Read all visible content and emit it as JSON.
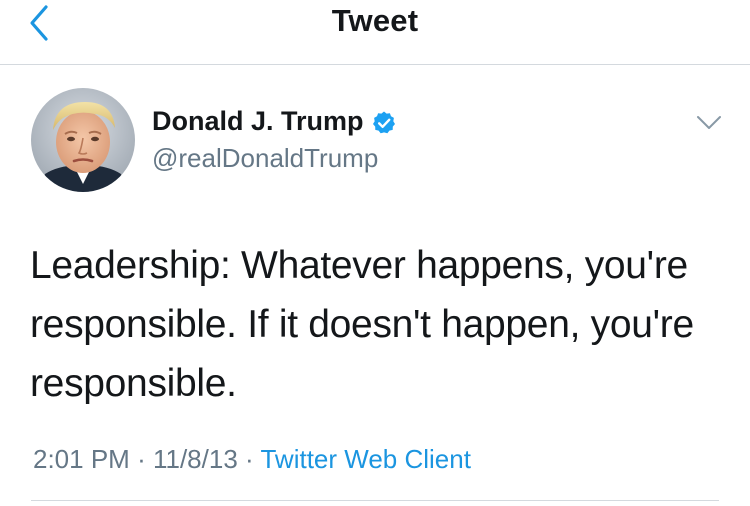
{
  "nav": {
    "title": "Tweet",
    "back_icon": "chevron-left-icon"
  },
  "author": {
    "display_name": "Donald J. Trump",
    "handle": "@realDonaldTrump",
    "verified": true,
    "verified_icon": "verified-badge-icon"
  },
  "tweet": {
    "text": "Leadership: Whatever happens, you're responsible. If it doesn't happen, you're responsible.",
    "time": "2:01 PM",
    "separator": "·",
    "date": "11/8/13",
    "source": "Twitter Web Client",
    "more_icon": "chevron-down-icon"
  },
  "colors": {
    "accent": "#1b95e0",
    "verified": "#1da1f2",
    "secondary_text": "#657786",
    "primary_text": "#14171a",
    "divider": "#d4d9de"
  }
}
